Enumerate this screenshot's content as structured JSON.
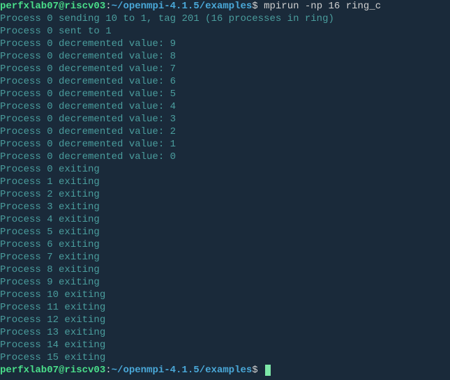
{
  "prompt1": {
    "user_host": "perfxlab07@riscv03",
    "colon": ":",
    "path": "~/openmpi-4.1.5/examples",
    "dollar": "$",
    "command": " mpirun -np 16 ring_c"
  },
  "output_lines": [
    "Process 0 sending 10 to 1, tag 201 (16 processes in ring)",
    "Process 0 sent to 1",
    "Process 0 decremented value: 9",
    "Process 0 decremented value: 8",
    "Process 0 decremented value: 7",
    "Process 0 decremented value: 6",
    "Process 0 decremented value: 5",
    "Process 0 decremented value: 4",
    "Process 0 decremented value: 3",
    "Process 0 decremented value: 2",
    "Process 0 decremented value: 1",
    "Process 0 decremented value: 0",
    "Process 0 exiting",
    "Process 1 exiting",
    "Process 2 exiting",
    "Process 3 exiting",
    "Process 4 exiting",
    "Process 5 exiting",
    "Process 6 exiting",
    "Process 7 exiting",
    "Process 8 exiting",
    "Process 9 exiting",
    "Process 10 exiting",
    "Process 11 exiting",
    "Process 12 exiting",
    "Process 13 exiting",
    "Process 14 exiting",
    "Process 15 exiting"
  ],
  "prompt2": {
    "user_host": "perfxlab07@riscv03",
    "colon": ":",
    "path": "~/openmpi-4.1.5/examples",
    "dollar": "$"
  }
}
